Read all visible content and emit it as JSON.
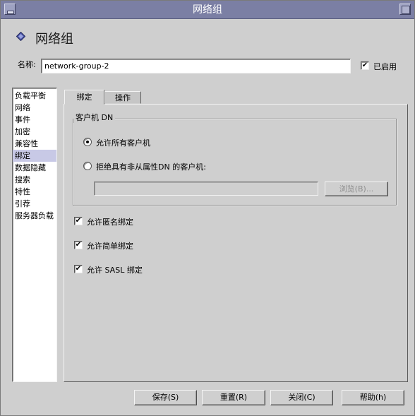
{
  "window": {
    "title": "网络组"
  },
  "header": {
    "icon": "diamond-icon",
    "title": "网络组"
  },
  "name_field": {
    "label": "名称:",
    "value": "network-group-2"
  },
  "enabled": {
    "label": "已启用",
    "checked": true
  },
  "nav": {
    "items": [
      "负载平衡",
      "网络",
      "事件",
      "加密",
      "兼容性",
      "绑定",
      "数据隐藏",
      "搜索",
      "特性",
      "引荐",
      "服务器负载"
    ],
    "selected": "绑定"
  },
  "tabs": [
    {
      "label": "绑定",
      "active": true
    },
    {
      "label": "操作",
      "active": false
    }
  ],
  "client_dn": {
    "group_title": "客户机 DN",
    "option_allow_all": "允许所有客户机",
    "option_reject": "拒绝具有非从属性DN 的客户机:",
    "selected_option": "allow_all",
    "dn_value": "",
    "browse_label": "浏览(B)..."
  },
  "options": [
    {
      "label": "允许匿名绑定",
      "checked": true
    },
    {
      "label": "允许简单绑定",
      "checked": true
    },
    {
      "label": "允许 SASL 绑定",
      "checked": true
    }
  ],
  "buttons": {
    "save": "保存(S)",
    "reset": "重置(R)",
    "close": "关闭(C)",
    "help": "帮助(h)"
  },
  "colors": {
    "titlebar": "#7b7fa4",
    "background": "#cfcfcf",
    "selection": "#c8c9e6"
  }
}
